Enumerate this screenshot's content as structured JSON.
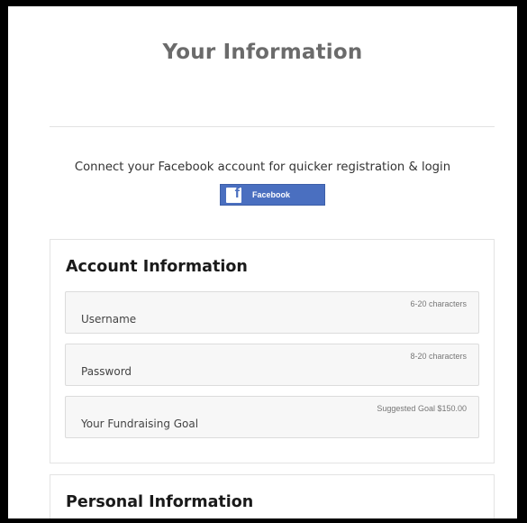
{
  "page": {
    "title": "Your Information"
  },
  "facebook": {
    "prompt": "Connect your Facebook account for quicker registration & login",
    "icon": "facebook-f-icon",
    "icon_glyph": "f",
    "button_label": "Facebook",
    "brand_color": "#4a6fc0"
  },
  "account_section": {
    "title": "Account Information",
    "fields": [
      {
        "label": "Username",
        "hint": "6-20 characters"
      },
      {
        "label": "Password",
        "hint": "8-20 characters"
      },
      {
        "label": "Your Fundraising Goal",
        "hint": "Suggested Goal $150.00"
      }
    ]
  },
  "personal_section": {
    "title": "Personal Information"
  }
}
